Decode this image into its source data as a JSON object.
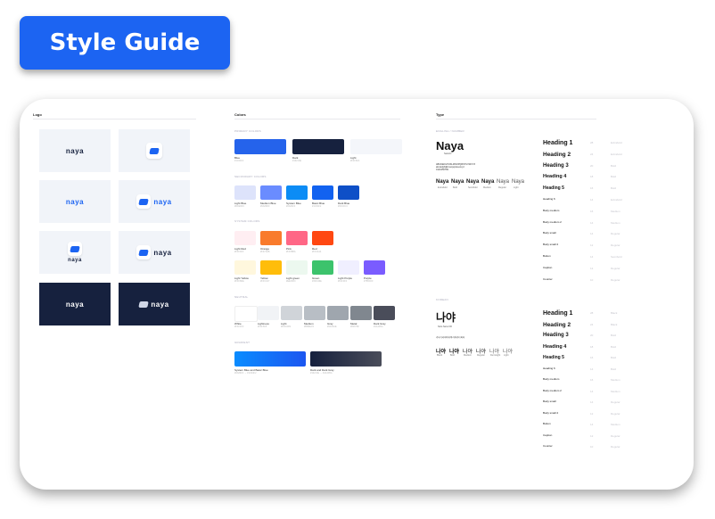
{
  "banner": {
    "title": "Style Guide"
  },
  "sections": {
    "logo": "Logo",
    "colors": "Colors",
    "type": "Type"
  },
  "logo": {
    "wordmark": "naya"
  },
  "colors": {
    "groups": {
      "primary": "PRIMARY COLORS",
      "secondary": "SECONDARY COLORS",
      "system": "SYSTEM COLORS",
      "neutral": "NEUTRAL",
      "gradient": "GRADIENT"
    },
    "primary": [
      {
        "name": "Blue",
        "hex": "#1C64F2",
        "color": "#2563eb"
      },
      {
        "name": "Dark",
        "hex": "#16213E",
        "color": "#16213e"
      },
      {
        "name": "Light",
        "hex": "#F4F6FA",
        "color": "#f4f6fa"
      }
    ],
    "secondary": [
      {
        "name": "Light Blue",
        "hex": "#DDE5FF",
        "color": "#dde3fb"
      },
      {
        "name": "Medium Blue",
        "hex": "#6A8DFF",
        "color": "#6a8cff"
      },
      {
        "name": "System Blue",
        "hex": "#0A84FF",
        "color": "#0c8cf5"
      },
      {
        "name": "Basic Blue",
        "hex": "#1C64F2",
        "color": "#1262f0"
      },
      {
        "name": "Dark Blue",
        "hex": "#0F4CC4",
        "color": "#0e4fc7"
      }
    ],
    "system_row1": [
      {
        "name": "Light Red",
        "hex": "#FFF0F3",
        "color": "#ffeef2"
      },
      {
        "name": "Orange",
        "hex": "#F97A2B",
        "color": "#f97b2c"
      },
      {
        "name": "Pink",
        "hex": "#FF6B8A",
        "color": "#ff6786"
      },
      {
        "name": "Red",
        "hex": "#FF4A14",
        "color": "#ff4812"
      }
    ],
    "system_row2": [
      {
        "name": "Light Yellow",
        "hex": "#FFF8DE",
        "color": "#fff7dd"
      },
      {
        "name": "Yellow",
        "hex": "#FFC107",
        "color": "#ffbd0a"
      },
      {
        "name": "Light green",
        "hex": "#EEF9F0",
        "color": "#ecf8ef"
      },
      {
        "name": "Green",
        "hex": "#3DC46E",
        "color": "#3cc36c"
      },
      {
        "name": "Light Purple",
        "hex": "#F1F0FF",
        "color": "#f0efff"
      },
      {
        "name": "Purple",
        "hex": "#7B5CFF",
        "color": "#7a5cff"
      }
    ],
    "neutral": [
      {
        "name": "White",
        "hex": "#FFFFFF",
        "color": "#ffffff"
      },
      {
        "name": "Lightness",
        "hex": "#F3F5F8",
        "color": "#f1f3f6"
      },
      {
        "name": "Light",
        "hex": "#D0D4D9",
        "color": "#d0d4d9"
      },
      {
        "name": "Medium",
        "hex": "#B8BEC5",
        "color": "#b8bec5"
      },
      {
        "name": "Gray",
        "hex": "#9FA6AE",
        "color": "#9fa6ae"
      },
      {
        "name": "Metal",
        "hex": "#80878F",
        "color": "#80878f"
      },
      {
        "name": "Dark Gray",
        "hex": "#4A4D5A",
        "color": "#4a4d5a"
      }
    ],
    "gradients": [
      {
        "name": "System Blue and Basic Blue",
        "hex": "#0A84FF → #1C64F2",
        "from": "#0a8cff",
        "to": "#1c56f0"
      },
      {
        "name": "Dark and Dark Gray",
        "hex": "#16213E → #4A4D5A",
        "from": "#16213e",
        "to": "#4a4d5a"
      }
    ]
  },
  "type": {
    "english_label": "ENGLISH / NUMBER",
    "english_sample": "Naya",
    "english_font": "Satoshi",
    "alphabet": "ABCDEFGHIJKLMNOPQRSTUVWXYZ",
    "alphabet_lower": "abcdefghijklmnopqrstuvwxyz",
    "digits": "0123456789",
    "english_weights": [
      {
        "sample": "Naya",
        "label": "Extrabold"
      },
      {
        "sample": "Naya",
        "label": "Bold"
      },
      {
        "sample": "Naya",
        "label": "Semibold"
      },
      {
        "sample": "Naya",
        "label": "Medium"
      },
      {
        "sample": "Naya",
        "label": "Regular"
      },
      {
        "sample": "Naya",
        "label": "Light"
      }
    ],
    "korean_label": "KOREAN",
    "korean_sample": "나야",
    "korean_font": "Noto Sans KR",
    "korean_chars": "가나다라마바사아자차카타파하",
    "korean_weights": [
      {
        "sample": "나야",
        "label": "Black"
      },
      {
        "sample": "나야",
        "label": "Bold"
      },
      {
        "sample": "나야",
        "label": "Medium"
      },
      {
        "sample": "나야",
        "label": "Regular"
      },
      {
        "sample": "나야",
        "label": "DemiLight"
      },
      {
        "sample": "나야",
        "label": "Light"
      }
    ],
    "scale_en": [
      {
        "name": "Heading 1",
        "size": "28",
        "weight": "Extrabold"
      },
      {
        "name": "Heading 2",
        "size": "24",
        "weight": "Extrabold"
      },
      {
        "name": "Heading 3",
        "size": "20",
        "weight": "Bold"
      },
      {
        "name": "Heading 4",
        "size": "18",
        "weight": "Bold"
      },
      {
        "name": "Heading 5",
        "size": "16",
        "weight": "Bold"
      },
      {
        "name": "Heading 6",
        "size": "14",
        "weight": "Extrabold"
      },
      {
        "name": "Body medium",
        "size": "16",
        "weight": "Medium"
      },
      {
        "name": "Body medium 2",
        "size": "14",
        "weight": "Medium"
      },
      {
        "name": "Body small",
        "size": "14",
        "weight": "Regular"
      },
      {
        "name": "Body small 2",
        "size": "12",
        "weight": "Regular"
      },
      {
        "name": "Button",
        "size": "14",
        "weight": "Semibold"
      },
      {
        "name": "Caption",
        "size": "12",
        "weight": "Regular"
      },
      {
        "name": "Counter",
        "size": "10",
        "weight": "Regular"
      }
    ],
    "scale_kr": [
      {
        "name": "Heading 1",
        "size": "28",
        "weight": "Black"
      },
      {
        "name": "Heading 2",
        "size": "24",
        "weight": "Black"
      },
      {
        "name": "Heading 3",
        "size": "20",
        "weight": "Bold"
      },
      {
        "name": "Heading 4",
        "size": "18",
        "weight": "Bold"
      },
      {
        "name": "Heading 5",
        "size": "16",
        "weight": "Bold"
      },
      {
        "name": "Heading 6",
        "size": "14",
        "weight": "Bold"
      },
      {
        "name": "Body medium",
        "size": "16",
        "weight": "Medium"
      },
      {
        "name": "Body medium 2",
        "size": "14",
        "weight": "Medium"
      },
      {
        "name": "Body small",
        "size": "14",
        "weight": "Regular"
      },
      {
        "name": "Body small 2",
        "size": "12",
        "weight": "Regular"
      },
      {
        "name": "Button",
        "size": "14",
        "weight": "Medium"
      },
      {
        "name": "Caption",
        "size": "12",
        "weight": "Regular"
      },
      {
        "name": "Counter",
        "size": "10",
        "weight": "Regular"
      }
    ]
  }
}
